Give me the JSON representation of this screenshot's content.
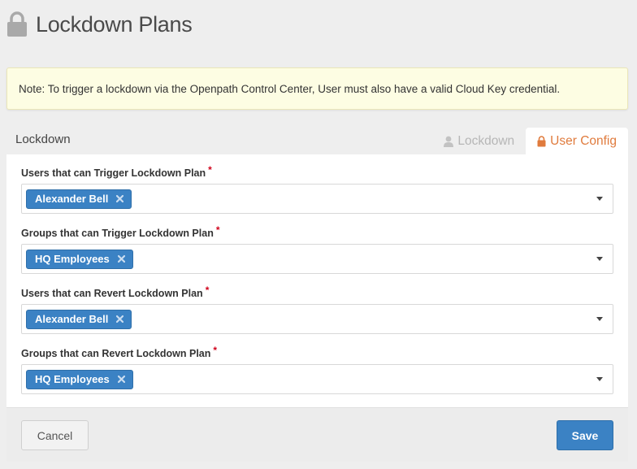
{
  "header": {
    "title": "Lockdown Plans",
    "icon": "lock-icon"
  },
  "note": {
    "text": "Note: To trigger a lockdown via the Openpath Control Center, User must also have a valid Cloud Key credential."
  },
  "panel": {
    "title": "Lockdown"
  },
  "tabs": [
    {
      "label": "Lockdown",
      "icon": "user-icon",
      "active": false
    },
    {
      "label": "User Config",
      "icon": "lock-icon",
      "active": true
    }
  ],
  "fields": [
    {
      "label": "Users that can Trigger Lockdown Plan",
      "required": "*",
      "chips": [
        "Alexander Bell"
      ]
    },
    {
      "label": "Groups that can Trigger Lockdown Plan",
      "required": "*",
      "chips": [
        "HQ Employees"
      ]
    },
    {
      "label": "Users that can Revert Lockdown Plan",
      "required": "*",
      "chips": [
        "Alexander Bell"
      ]
    },
    {
      "label": "Groups that can Revert Lockdown Plan",
      "required": "*",
      "chips": [
        "HQ Employees"
      ]
    }
  ],
  "footer": {
    "cancel_label": "Cancel",
    "save_label": "Save"
  },
  "colors": {
    "accent": "#3b82c4",
    "active_tab": "#e07b3d",
    "required": "#d0021b",
    "note_bg": "#fdfde3"
  }
}
